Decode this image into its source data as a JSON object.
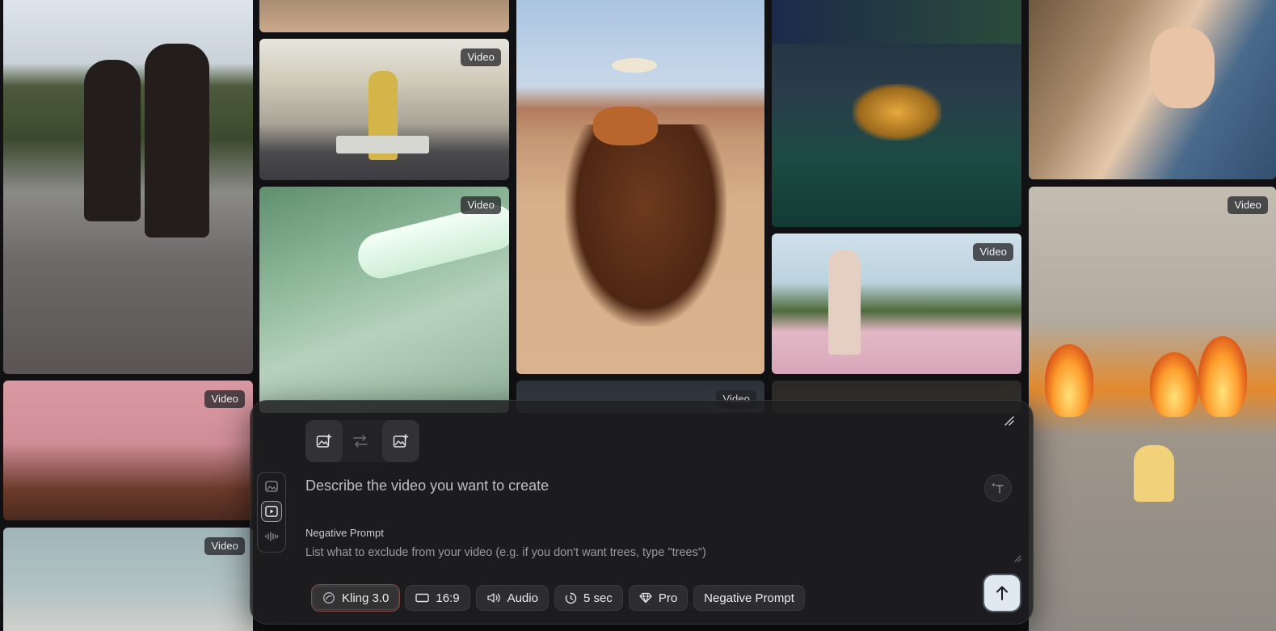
{
  "gallery": {
    "badges": {
      "yellow_suit": "Video",
      "green_bathroom": "Video",
      "pink_room": "Video",
      "water": "Video",
      "tennis": "Video",
      "office": "Video",
      "subway": "Video"
    }
  },
  "composer": {
    "prompt_placeholder": "Describe the video you want to create",
    "negative_label": "Negative Prompt",
    "negative_placeholder": "List what to exclude from your video (e.g. if you don't want trees, type \"trees\")",
    "chips": {
      "model": "Kling 3.0",
      "aspect": "16:9",
      "audio": "Audio",
      "duration": "5 sec",
      "quality": "Pro",
      "negative": "Negative Prompt"
    }
  },
  "icons": {
    "start_frame": "add-image-icon",
    "swap": "swap-arrows-icon",
    "end_frame": "add-image-icon",
    "mode_image": "image-icon",
    "mode_video": "video-play-icon",
    "mode_audio": "audio-wave-icon",
    "enhance": "text-sparkle-icon",
    "collapse": "collapse-diagonal-icon",
    "model": "kling-logo-icon",
    "aspect": "aspect-ratio-icon",
    "audio": "speaker-icon",
    "duration": "timer-icon",
    "quality": "diamond-icon",
    "submit": "arrow-up-icon"
  },
  "colors": {
    "panel_bg": "#1e1e21",
    "submit_bg": "#dfe9ef",
    "model_chip_accent": "#e66e6e"
  }
}
